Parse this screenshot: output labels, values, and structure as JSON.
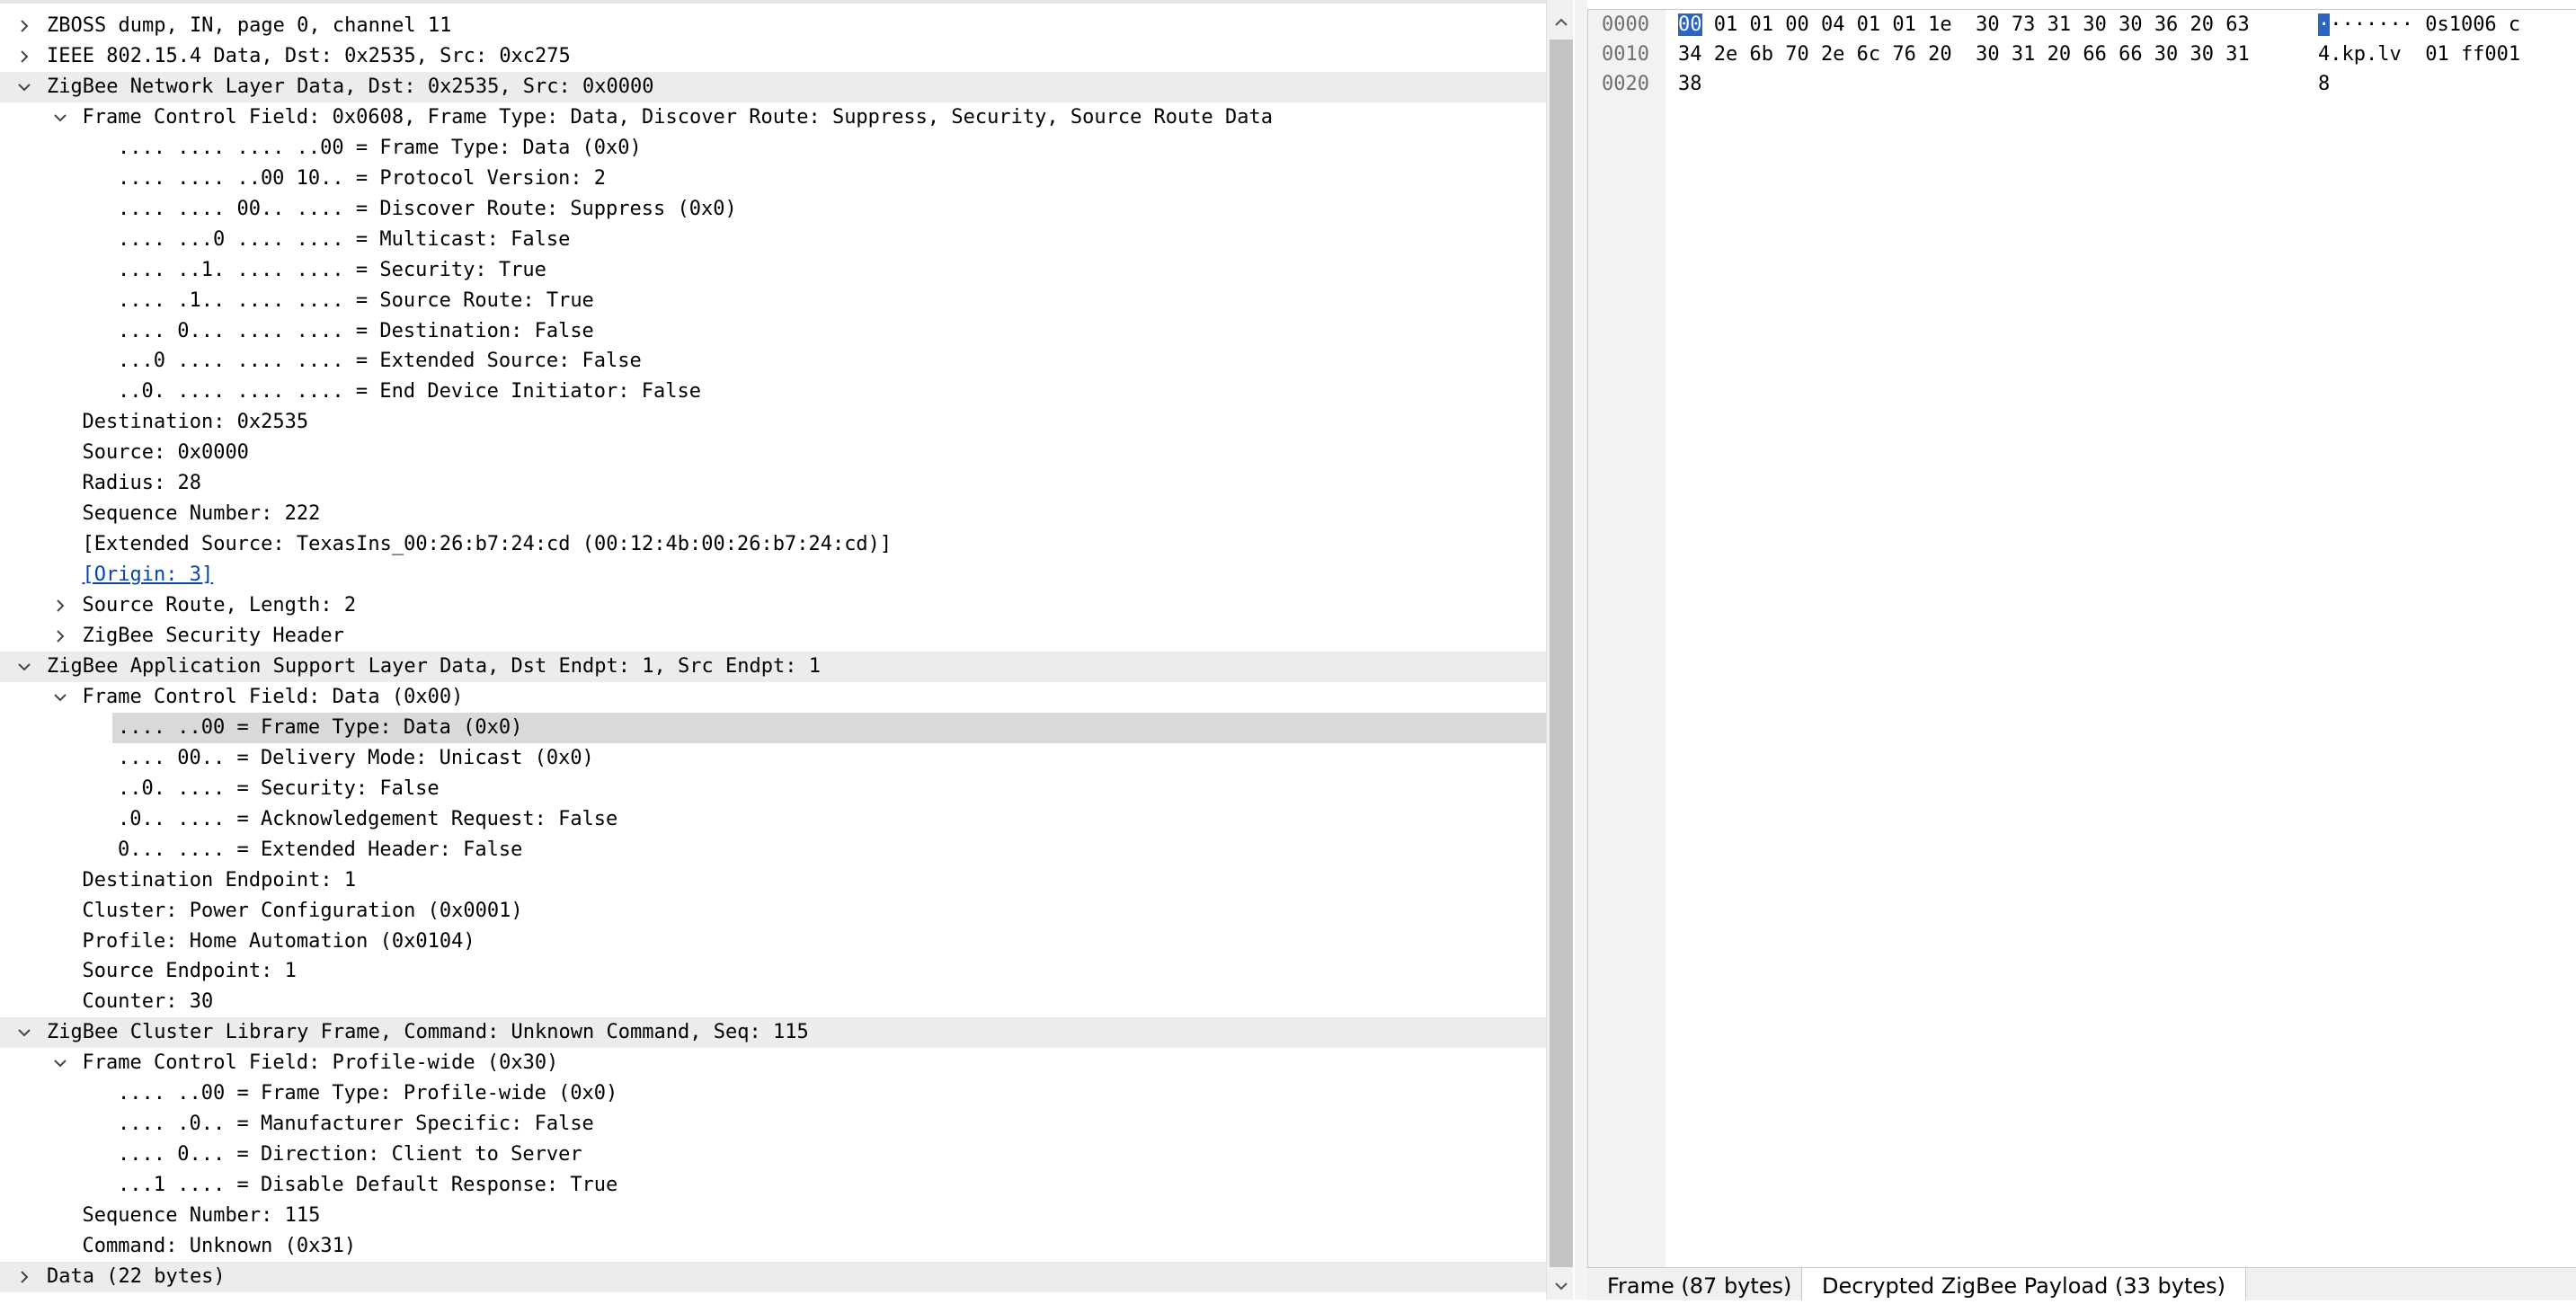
{
  "tree": {
    "rows": [
      {
        "text": "ZBOSS dump, IN, page 0, channel 11"
      },
      {
        "text": "IEEE 802.15.4 Data, Dst: 0x2535, Src: 0xc275"
      },
      {
        "text": "ZigBee Network Layer Data, Dst: 0x2535, Src: 0x0000"
      },
      {
        "text": "Frame Control Field: 0x0608, Frame Type: Data, Discover Route: Suppress, Security, Source Route Data"
      },
      {
        "text": ".... .... .... ..00 = Frame Type: Data (0x0)"
      },
      {
        "text": ".... .... ..00 10.. = Protocol Version: 2"
      },
      {
        "text": ".... .... 00.. .... = Discover Route: Suppress (0x0)"
      },
      {
        "text": ".... ...0 .... .... = Multicast: False"
      },
      {
        "text": ".... ..1. .... .... = Security: True"
      },
      {
        "text": ".... .1.. .... .... = Source Route: True"
      },
      {
        "text": ".... 0... .... .... = Destination: False"
      },
      {
        "text": "...0 .... .... .... = Extended Source: False"
      },
      {
        "text": "..0. .... .... .... = End Device Initiator: False"
      },
      {
        "text": "Destination: 0x2535"
      },
      {
        "text": "Source: 0x0000"
      },
      {
        "text": "Radius: 28"
      },
      {
        "text": "Sequence Number: 222"
      },
      {
        "text": "[Extended Source: TexasIns_00:26:b7:24:cd (00:12:4b:00:26:b7:24:cd)]"
      },
      {
        "text": "[Origin: 3]"
      },
      {
        "text": "Source Route, Length: 2"
      },
      {
        "text": "ZigBee Security Header"
      },
      {
        "text": "ZigBee Application Support Layer Data, Dst Endpt: 1, Src Endpt: 1"
      },
      {
        "text": "Frame Control Field: Data (0x00)"
      },
      {
        "text": ".... ..00 = Frame Type: Data (0x0)"
      },
      {
        "text": ".... 00.. = Delivery Mode: Unicast (0x0)"
      },
      {
        "text": "..0. .... = Security: False"
      },
      {
        "text": ".0.. .... = Acknowledgement Request: False"
      },
      {
        "text": "0... .... = Extended Header: False"
      },
      {
        "text": "Destination Endpoint: 1"
      },
      {
        "text": "Cluster: Power Configuration (0x0001)"
      },
      {
        "text": "Profile: Home Automation (0x0104)"
      },
      {
        "text": "Source Endpoint: 1"
      },
      {
        "text": "Counter: 30"
      },
      {
        "text": "ZigBee Cluster Library Frame, Command: Unknown Command, Seq: 115"
      },
      {
        "text": "Frame Control Field: Profile-wide (0x30)"
      },
      {
        "text": ".... ..00 = Frame Type: Profile-wide (0x0)"
      },
      {
        "text": ".... .0.. = Manufacturer Specific: False"
      },
      {
        "text": ".... 0... = Direction: Client to Server"
      },
      {
        "text": "...1 .... = Disable Default Response: True"
      },
      {
        "text": "Sequence Number: 115"
      },
      {
        "text": "Command: Unknown (0x31)"
      },
      {
        "text": "Data (22 bytes)"
      }
    ]
  },
  "hex": {
    "lines": [
      {
        "offset": "0000",
        "first_byte": "00",
        "bytes_rest": " 01 01 00 04 01 01 1e  30 73 31 30 30 36 20 63",
        "ascii_first": "·",
        "ascii_rest": "······· 0s1006 c"
      },
      {
        "offset": "0010",
        "first_byte": "",
        "bytes_rest": "34 2e 6b 70 2e 6c 76 20  30 31 20 66 66 30 30 31",
        "ascii_first": "",
        "ascii_rest": "4.kp.lv  01 ff001"
      },
      {
        "offset": "0020",
        "first_byte": "",
        "bytes_rest": "38",
        "ascii_first": "",
        "ascii_rest": "8"
      }
    ]
  },
  "tabs": [
    {
      "label": "Frame (87 bytes)"
    },
    {
      "label": "Decrypted ZigBee Payload (33 bytes)"
    }
  ]
}
